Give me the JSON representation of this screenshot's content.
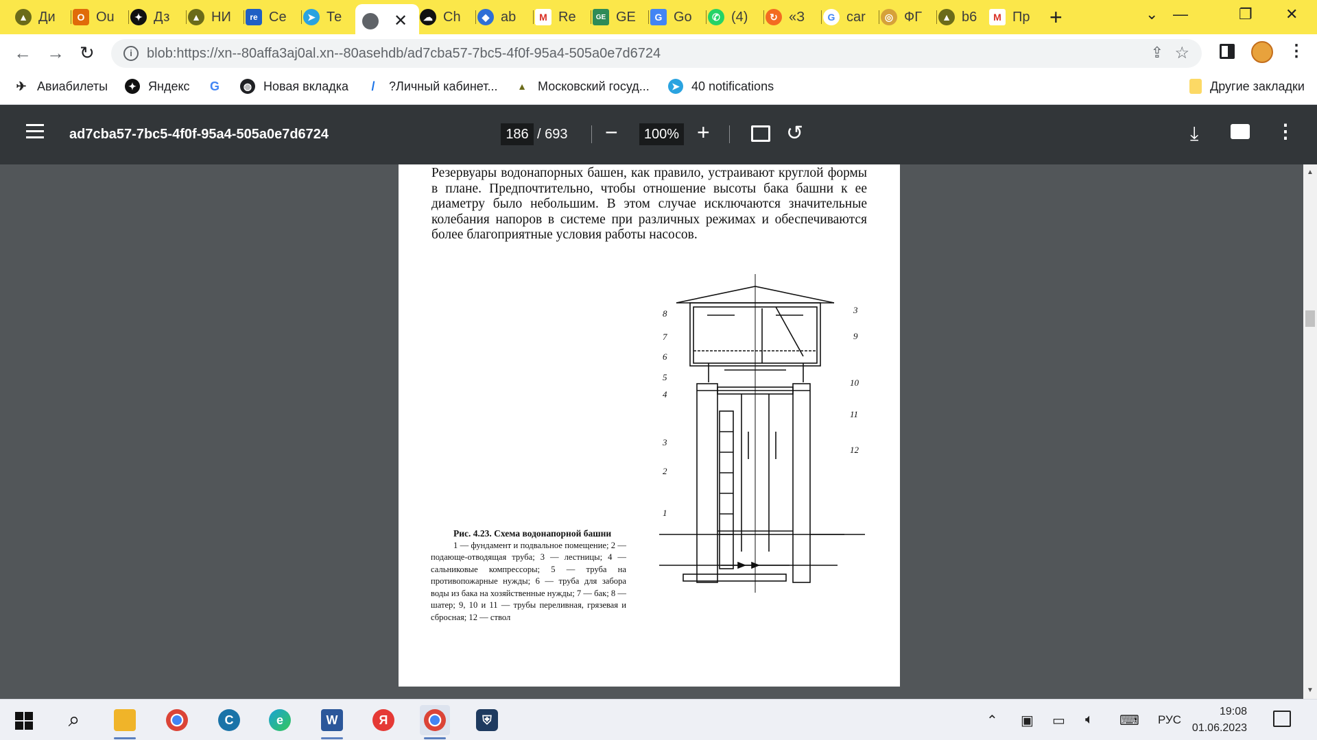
{
  "tabs": [
    {
      "title": "Ди",
      "icon": "academic-cap-icon",
      "color": "#6b6b1a"
    },
    {
      "title": "Ou",
      "icon": "outlook-icon",
      "color": "#e06b0a"
    },
    {
      "title": "Дз",
      "icon": "zen-icon",
      "color": "#111111"
    },
    {
      "title": "НИ",
      "icon": "academic-cap-icon",
      "color": "#6b6b1a"
    },
    {
      "title": "Се",
      "icon": "re-icon",
      "color": "#1f5fc4"
    },
    {
      "title": "Те",
      "icon": "telegram-icon",
      "color": "#2aa3e0"
    }
  ],
  "tabs_right": [
    {
      "title": "Ch",
      "icon": "chat-icon",
      "color": "#111111"
    },
    {
      "title": "ab",
      "icon": "abby-icon",
      "color": "#2f6fd6"
    },
    {
      "title": "Re",
      "icon": "gmail-icon",
      "color": "#d93025"
    },
    {
      "title": "GE",
      "icon": "ge-icon",
      "color": "#2e8b57"
    },
    {
      "title": "Go",
      "icon": "google-translate-icon",
      "color": "#4285f4"
    },
    {
      "title": "(4)",
      "icon": "whatsapp-icon",
      "color": "#25d366"
    },
    {
      "title": "«З",
      "icon": "reload-orange-icon",
      "color": "#f36b21"
    },
    {
      "title": "car",
      "icon": "google-icon",
      "color": "#4285f4"
    },
    {
      "title": "ФГ",
      "icon": "emblem-icon",
      "color": "#d6a13a"
    },
    {
      "title": "b6",
      "icon": "academic-cap-icon",
      "color": "#6b6b1a"
    },
    {
      "title": "Пр",
      "icon": "gmail-icon",
      "color": "#d93025"
    }
  ],
  "url": "blob:https://xn--80affa3aj0al.xn--80asehdb/ad7cba57-7bc5-4f0f-95a4-505a0e7d6724",
  "bookmarks": [
    {
      "label": "Авиабилеты",
      "icon": "plane-icon"
    },
    {
      "label": "Яндекс",
      "icon": "zen-icon"
    },
    {
      "label": "",
      "icon": "google-icon"
    },
    {
      "label": "Новая вкладка",
      "icon": "globe-icon"
    },
    {
      "label": "?Личный кабинет...",
      "icon": "pen-icon"
    },
    {
      "label": "Московский госуд...",
      "icon": "academic-cap-icon"
    },
    {
      "label": "40 notifications",
      "icon": "telegram-icon"
    }
  ],
  "other_bookmarks": "Другие закладки",
  "pdf": {
    "title": "ad7cba57-7bc5-4f0f-95a4-505a0e7d6724",
    "page": "186",
    "total": "/  693",
    "zoom": "100%"
  },
  "document": {
    "paragraph": "Резервуары водонапорных башен, как правило, устраивают круглой формы в плане. Предпочтительно, чтобы отношение высоты бака башни к ее диаметру было небольшим. В этом случае исключаются значительные колебания напоров в системе при различных режимах и обеспечиваются более благоприятные условия работы насосов.",
    "caption_title": "Рис. 4.23. Схема водонапорной башни",
    "caption_body": "1 — фундамент и подвальное помещение; 2 — подающе-отводящая труба; 3 — лестницы; 4 — сальниковые компрессоры; 5 — труба на противопожарные нужды; 6 — труба для забора воды из бака на хозяйственные нужды; 7 — бак; 8 — шатер; 9, 10 и 11 — трубы переливная, грязевая и сбросная; 12 — ствол",
    "figure_labels_left": [
      "8",
      "7",
      "6",
      "5",
      "4",
      "3",
      "2",
      "1"
    ],
    "figure_labels_right": [
      "3",
      "9",
      "10",
      "11",
      "12"
    ]
  },
  "taskbar": {
    "apps": [
      {
        "name": "search",
        "icon": "search-icon"
      },
      {
        "name": "explorer",
        "icon": "folder-icon",
        "color": "#f0b429"
      },
      {
        "name": "chrome",
        "icon": "chrome-icon",
        "color": "#db4437"
      },
      {
        "name": "app-c",
        "icon": "c-circle-icon",
        "color": "#1a73a8"
      },
      {
        "name": "edge",
        "icon": "edge-icon",
        "color": "#1aa2d6"
      },
      {
        "name": "word",
        "icon": "word-icon",
        "color": "#2b579a"
      },
      {
        "name": "yandex",
        "icon": "yandex-icon",
        "color": "#e53935"
      },
      {
        "name": "chrome-profile",
        "icon": "chrome-icon",
        "color": "#db4437"
      },
      {
        "name": "vpn",
        "icon": "shield-icon",
        "color": "#1e88e5"
      }
    ],
    "lang": "РУС",
    "time": "19:08",
    "date": "01.06.2023"
  }
}
